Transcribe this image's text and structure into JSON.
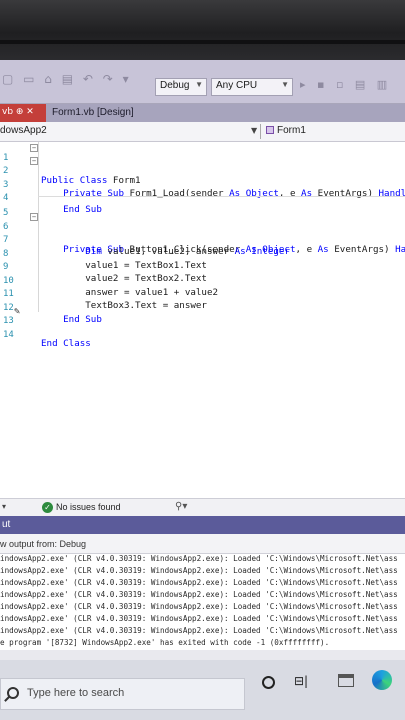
{
  "toolbar": {
    "config_combo": "Debug",
    "platform_combo": "Any CPU"
  },
  "tabs": {
    "active_tab_label": "vb  ⊕ ✕",
    "designer_tab_label": "Form1.vb [Design]"
  },
  "navbar": {
    "project": "dowsApp2",
    "class_selector": "Form1"
  },
  "editor": {
    "lines": [
      {
        "n": "1",
        "text": "Public Class Form1"
      },
      {
        "n": "2",
        "text": "    Private Sub Form1_Load(sender As Object, e As EventArgs) Handle"
      },
      {
        "n": "3",
        "text": ""
      },
      {
        "n": "4",
        "text": "    End Sub"
      },
      {
        "n": "5",
        "text": ""
      },
      {
        "n": "6",
        "text": "    Private Sub Button1_Click(sender As Object, e As EventArgs) Han"
      },
      {
        "n": "7",
        "text": "        Dim value1, value2, answer As Integer"
      },
      {
        "n": "8",
        "text": "        value1 = TextBox1.Text"
      },
      {
        "n": "9",
        "text": "        value2 = TextBox2.Text"
      },
      {
        "n": "10",
        "text": "        answer = value1 + value2"
      },
      {
        "n": "11",
        "text": "        TextBox3.Text = answer"
      },
      {
        "n": "12",
        "text": "    End Sub"
      },
      {
        "n": "13",
        "text": "End Class"
      },
      {
        "n": "14",
        "text": ""
      }
    ]
  },
  "status": {
    "issues": "No issues found"
  },
  "output": {
    "title": "ut",
    "show_output_from": "w output from:  Debug",
    "lines": [
      "indowsApp2.exe' (CLR v4.0.30319: WindowsApp2.exe): Loaded 'C:\\Windows\\Microsoft.Net\\ass",
      "indowsApp2.exe' (CLR v4.0.30319: WindowsApp2.exe): Loaded 'C:\\Windows\\Microsoft.Net\\ass",
      "indowsApp2.exe' (CLR v4.0.30319: WindowsApp2.exe): Loaded 'C:\\Windows\\Microsoft.Net\\ass",
      "indowsApp2.exe' (CLR v4.0.30319: WindowsApp2.exe): Loaded 'C:\\Windows\\Microsoft.Net\\ass",
      "indowsApp2.exe' (CLR v4.0.30319: WindowsApp2.exe): Loaded 'C:\\Windows\\Microsoft.Net\\ass",
      "indowsApp2.exe' (CLR v4.0.30319: WindowsApp2.exe): Loaded 'C:\\Windows\\Microsoft.Net\\ass",
      "indowsApp2.exe' (CLR v4.0.30319: WindowsApp2.exe): Loaded 'C:\\Windows\\Microsoft.Net\\ass",
      "e program '[8732] WindowsApp2.exe' has exited with code -1 (0xffffffff)."
    ]
  },
  "taskbar": {
    "search_placeholder": "Type here to search"
  }
}
